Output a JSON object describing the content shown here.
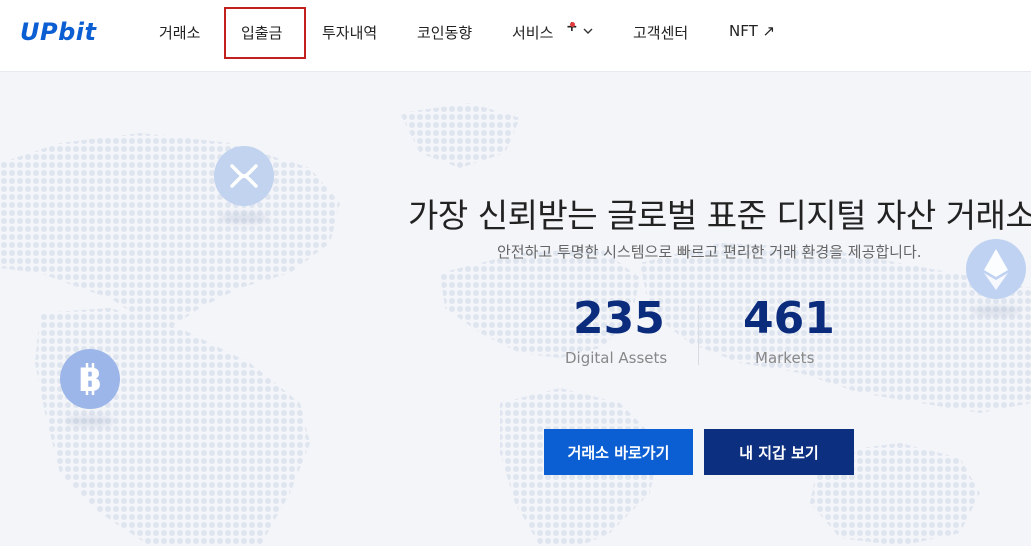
{
  "header": {
    "logo": "UPbit",
    "nav": [
      {
        "label": "거래소"
      },
      {
        "label": "입출금"
      },
      {
        "label": "투자내역"
      },
      {
        "label": "코인동향"
      },
      {
        "label": "서비스"
      },
      {
        "label": "고객센터"
      },
      {
        "label": "NFT ↗"
      }
    ],
    "service_badge": "+"
  },
  "hero": {
    "headline": "가장 신뢰받는 글로벌 표준 디지털 자산 거래소",
    "subline": "안전하고 투명한 시스템으로 빠르고 편리한 거래 환경을 제공합니다.",
    "stats": [
      {
        "value": "235",
        "label": "Digital Assets"
      },
      {
        "value": "461",
        "label": "Markets"
      }
    ],
    "buttons": {
      "exchange": "거래소 바로가기",
      "wallet": "내 지갑 보기"
    }
  },
  "colors": {
    "brand": "#0b5fd3",
    "navy": "#0d2f7f",
    "highlight_border": "#c1201e"
  }
}
